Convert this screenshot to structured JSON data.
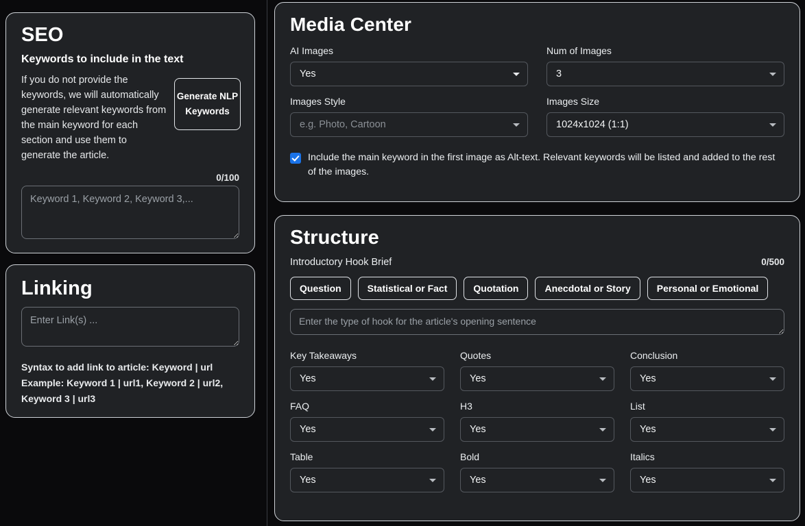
{
  "left_column": {
    "seo": {
      "title": "SEO",
      "subtitle": "Keywords to include in the text",
      "help_text": "If you do not provide the keywords, we will automatically generate relevant keywords from the main keyword for each section and use them to generate the article.",
      "generate_button": "Generate NLP Keywords",
      "counter": "0/100",
      "keywords_placeholder": "Keyword 1, Keyword 2, Keyword 3,...",
      "keywords_value": ""
    },
    "linking": {
      "title": "Linking",
      "links_placeholder": "Enter Link(s) ...",
      "links_value": "",
      "syntax_line1": "Syntax to add link to article: Keyword | url",
      "syntax_line2": "Example: Keyword 1 | url1, Keyword 2 | url2,",
      "syntax_line3": "Keyword 3 | url3"
    }
  },
  "right_column": {
    "media_center": {
      "title": "Media Center",
      "fields": {
        "ai_images": {
          "label": "AI Images",
          "value": "Yes",
          "is_placeholder": false
        },
        "num_of_images": {
          "label": "Num of Images",
          "value": "3",
          "is_placeholder": false
        },
        "images_style": {
          "label": "Images Style",
          "value": "e.g. Photo, Cartoon",
          "is_placeholder": true
        },
        "images_size": {
          "label": "Images Size",
          "value": "1024x1024 (1:1)",
          "is_placeholder": false
        }
      },
      "alt_text_checkbox": {
        "checked": true,
        "label": "Include the main keyword in the first image as Alt-text. Relevant keywords will be listed and added to the rest of the images."
      }
    },
    "structure": {
      "title": "Structure",
      "hook_label": "Introductory Hook Brief",
      "hook_counter": "0/500",
      "hook_chips": [
        "Question",
        "Statistical or Fact",
        "Quotation",
        "Anecdotal or Story",
        "Personal or Emotional"
      ],
      "hook_placeholder": "Enter the type of hook for the article's opening sentence",
      "hook_value": "",
      "options": [
        {
          "label": "Key Takeaways",
          "value": "Yes"
        },
        {
          "label": "Quotes",
          "value": "Yes"
        },
        {
          "label": "Conclusion",
          "value": "Yes"
        },
        {
          "label": "FAQ",
          "value": "Yes"
        },
        {
          "label": "H3",
          "value": "Yes"
        },
        {
          "label": "List",
          "value": "Yes"
        },
        {
          "label": "Table",
          "value": "Yes"
        },
        {
          "label": "Bold",
          "value": "Yes"
        },
        {
          "label": "Italics",
          "value": "Yes"
        }
      ]
    }
  },
  "icons": {
    "caret": "chevron-down-icon",
    "check": "check-icon"
  },
  "colors": {
    "page_background": "#0a0a0c",
    "card_background": "#202225",
    "card_border": "#cfd3d8",
    "accent_checkbox": "#1a73e8",
    "text_primary": "#ffffff",
    "text_muted": "#9aa0a6"
  }
}
